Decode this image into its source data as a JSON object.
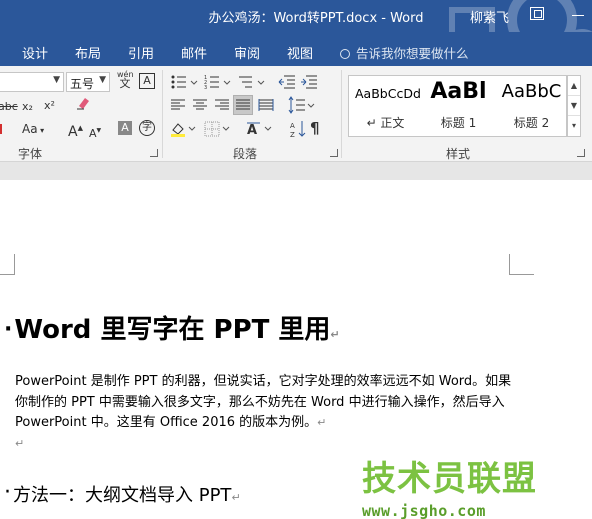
{
  "window": {
    "title": "办公鸡汤：Word转PPT.docx - Word",
    "user": "柳紫飞"
  },
  "tabs": [
    "设计",
    "布局",
    "引用",
    "邮件",
    "审阅",
    "视图"
  ],
  "tell_me": "告诉我你想要做什么",
  "ribbon": {
    "font_group": {
      "label": "字体",
      "font_size": "五号",
      "wen_label": "wén",
      "wen_char": "文",
      "a_box": "A",
      "strike": "abc",
      "sub": "x₂",
      "sup": "x²",
      "case": "Aa",
      "grow": "A",
      "shrink": "A",
      "char_shade": "A",
      "circle_char": "字"
    },
    "paragraph_group": {
      "label": "段落"
    },
    "styles_group": {
      "label": "样式",
      "items": [
        {
          "sample": "AaBbCcDd",
          "name": "↵ 正文"
        },
        {
          "sample": "AaBl",
          "name": "标题 1"
        },
        {
          "sample": "AaBbC",
          "name": "标题 2"
        }
      ]
    }
  },
  "document": {
    "heading1": "Word 里写字在 PPT 里用",
    "para1": "PowerPoint 是制作 PPT 的利器，但说实话，它对字处理的效率远远不如 Word。如果你制作的 PPT 中需要输入很多文字，那么不妨先在 Word 中进行输入操作，然后导入 PowerPoint 中。这里有 Office 2016 的版本为例。",
    "para_mark": "↵",
    "heading2": "方法一：大纲文档导入 PPT"
  },
  "watermark": {
    "title": "技术员联盟",
    "url": "www.jsgho.com"
  },
  "colors": {
    "accent": "#2b579a",
    "watermark_green": "#7cc242"
  }
}
